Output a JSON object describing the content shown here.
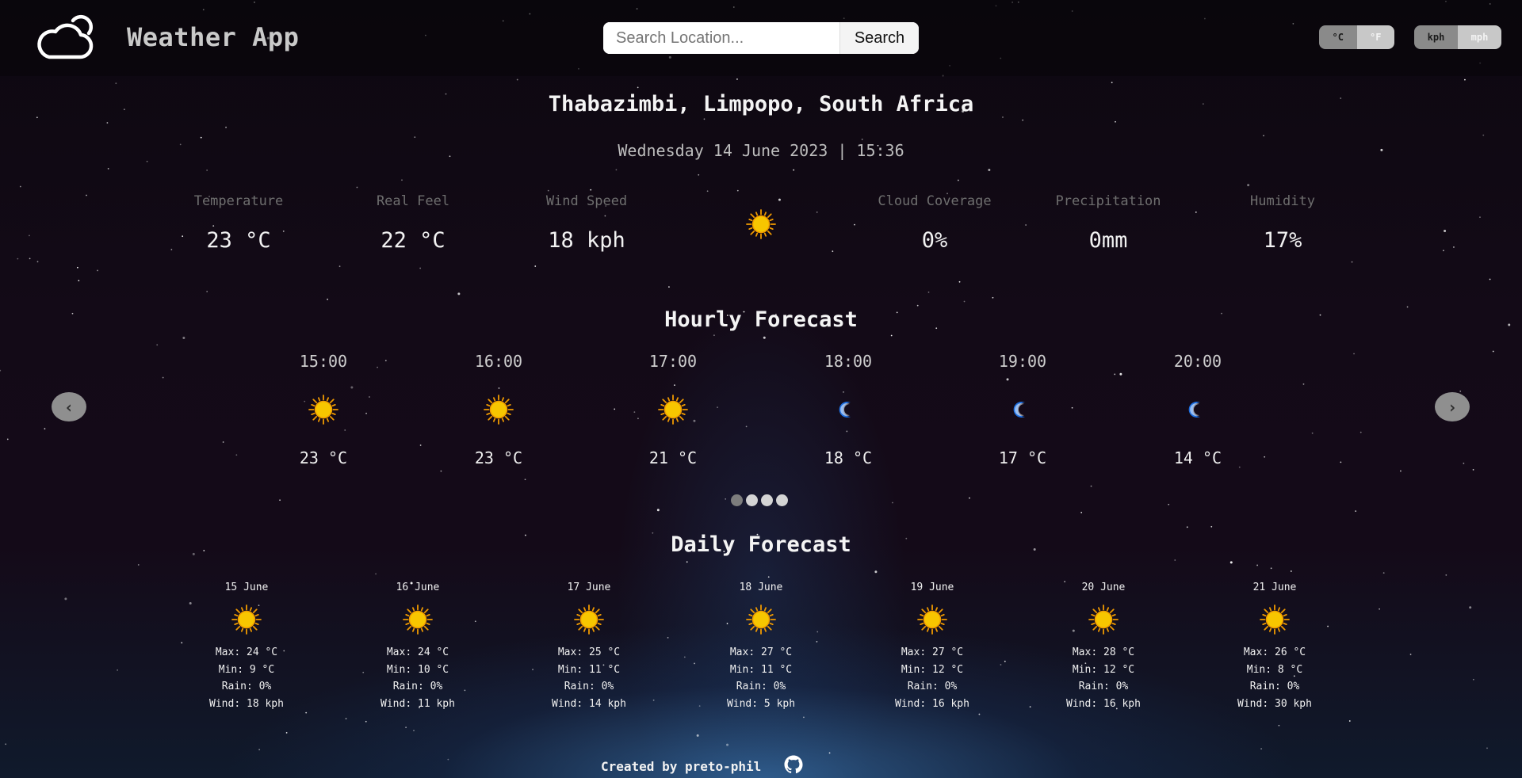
{
  "header": {
    "logo_icon": "cloud-icon",
    "title": "Weather App",
    "search": {
      "placeholder": "Search Location...",
      "value": "",
      "button_label": "Search"
    },
    "temp_toggle": {
      "options": [
        "°C",
        "°F"
      ],
      "selected": "°C"
    },
    "wind_toggle": {
      "options": [
        "kph",
        "mph"
      ],
      "selected": "kph"
    }
  },
  "location": "Thabazimbi, Limpopo, South Africa",
  "datetime": "Wednesday 14 June 2023 | 15:36",
  "current": {
    "icon": "sun-icon",
    "stats": [
      {
        "label": "Temperature",
        "value": "23 °C"
      },
      {
        "label": "Real Feel",
        "value": "22 °C"
      },
      {
        "label": "Wind Speed",
        "value": "18 kph"
      },
      {
        "label": "Cloud Coverage",
        "value": "0%"
      },
      {
        "label": "Precipitation",
        "value": "0mm"
      },
      {
        "label": "Humidity",
        "value": "17%"
      }
    ]
  },
  "hourly": {
    "title": "Hourly Forecast",
    "prev_icon": "chevron-left-icon",
    "next_icon": "chevron-right-icon",
    "prev_label": "‹",
    "next_label": "›",
    "pages": 4,
    "active_page": 1,
    "items": [
      {
        "time": "15:00",
        "icon": "sun-icon",
        "temp": "23 °C"
      },
      {
        "time": "16:00",
        "icon": "sun-icon",
        "temp": "23 °C"
      },
      {
        "time": "17:00",
        "icon": "sun-icon",
        "temp": "21 °C"
      },
      {
        "time": "18:00",
        "icon": "moon-icon",
        "temp": "18 °C"
      },
      {
        "time": "19:00",
        "icon": "moon-icon",
        "temp": "17 °C"
      },
      {
        "time": "20:00",
        "icon": "moon-icon",
        "temp": "14 °C"
      }
    ]
  },
  "daily": {
    "title": "Daily Forecast",
    "items": [
      {
        "date": "15 June",
        "icon": "sun-icon",
        "max": "Max: 24 °C",
        "min": "Min: 9 °C",
        "rain": "Rain: 0%",
        "wind": "Wind: 18 kph"
      },
      {
        "date": "16 June",
        "icon": "sun-icon",
        "max": "Max: 24 °C",
        "min": "Min: 10 °C",
        "rain": "Rain: 0%",
        "wind": "Wind: 11 kph"
      },
      {
        "date": "17 June",
        "icon": "sun-icon",
        "max": "Max: 25 °C",
        "min": "Min: 11 °C",
        "rain": "Rain: 0%",
        "wind": "Wind: 14 kph"
      },
      {
        "date": "18 June",
        "icon": "sun-icon",
        "max": "Max: 27 °C",
        "min": "Min: 11 °C",
        "rain": "Rain: 0%",
        "wind": "Wind: 5 kph"
      },
      {
        "date": "19 June",
        "icon": "sun-icon",
        "max": "Max: 27 °C",
        "min": "Min: 12 °C",
        "rain": "Rain: 0%",
        "wind": "Wind: 16 kph"
      },
      {
        "date": "20 June",
        "icon": "sun-icon",
        "max": "Max: 28 °C",
        "min": "Min: 12 °C",
        "rain": "Rain: 0%",
        "wind": "Wind: 16 kph"
      },
      {
        "date": "21 June",
        "icon": "sun-icon",
        "max": "Max: 26 °C",
        "min": "Min: 8 °C",
        "rain": "Rain: 0%",
        "wind": "Wind: 30 kph"
      }
    ]
  },
  "footer": {
    "text": "Created by preto-phil",
    "icon": "github-icon"
  },
  "colors": {
    "sun": "#f7c600",
    "sun_ray": "#f09a00",
    "moon": "#1e6fe0",
    "background": "#130a17"
  }
}
